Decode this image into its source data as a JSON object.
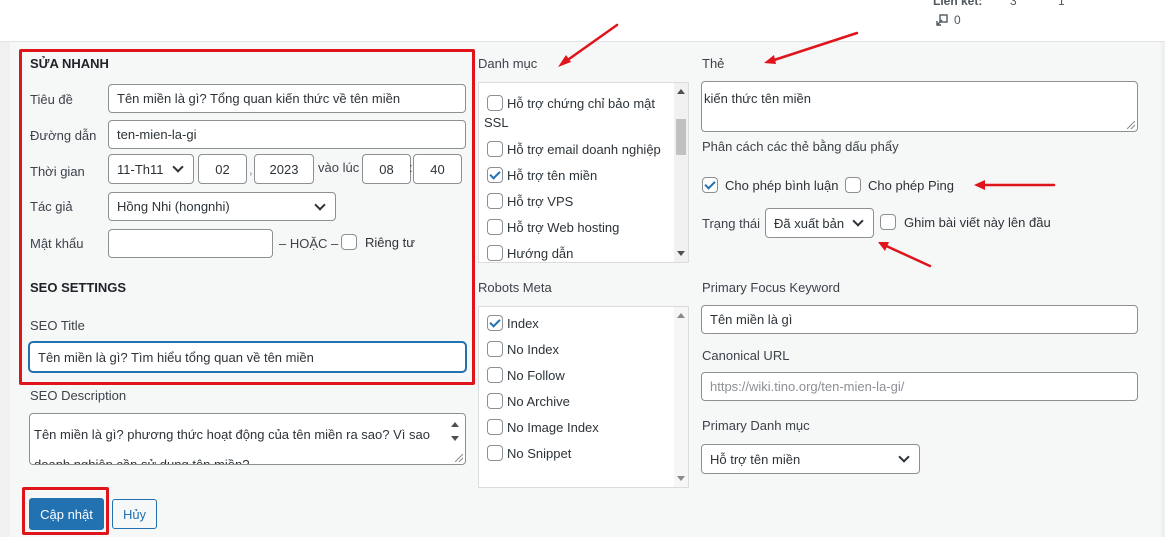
{
  "top": {
    "links_label": "Liên kết:",
    "links_counts": "3",
    "links_counts_2": "1",
    "incoming_count": "0"
  },
  "quick_edit": {
    "heading": "SỬA NHANH",
    "title_label": "Tiêu đề",
    "title_value": "Tên miền là gì? Tổng quan kiến thức về tên miền",
    "slug_label": "Đường dẫn",
    "slug_value": "ten-mien-la-gi",
    "date_label": "Thời gian",
    "month_value": "11-Th11",
    "day_value": "02",
    "year_value": "2023",
    "at_label": "vào lúc",
    "hour_value": "08",
    "minute_value": "40",
    "author_label": "Tác giả",
    "author_value": "Hồng Nhi (hongnhi)",
    "password_label": "Mật khẩu",
    "password_value": "",
    "or_label": "– HOẶC –",
    "private_label": "Riêng tư"
  },
  "seo": {
    "heading": "SEO SETTINGS",
    "title_label": "SEO Title",
    "title_value": "Tên miền là gì? Tìm hiểu tổng quan về tên miền",
    "description_label": "SEO Description",
    "description_value": "Tên miền là gì? phương thức hoạt động của tên miền ra sao? Vì sao doanh nghiệp cần sử dụng tên miền?"
  },
  "categories": {
    "heading": "Danh mục",
    "items": [
      {
        "label": "Hỗ trợ chứng chỉ bảo mật",
        "label_cont": "SSL",
        "checked": false
      },
      {
        "label": "Hỗ trợ email doanh nghiệp",
        "checked": false
      },
      {
        "label": "Hỗ trợ tên miền",
        "checked": true
      },
      {
        "label": "Hỗ trợ VPS",
        "checked": false
      },
      {
        "label": "Hỗ trợ Web hosting",
        "checked": false
      },
      {
        "label": "Hướng dẫn",
        "checked": false
      }
    ]
  },
  "robots": {
    "heading": "Robots Meta",
    "items": [
      {
        "label": "Index",
        "checked": true
      },
      {
        "label": "No Index",
        "checked": false
      },
      {
        "label": "No Follow",
        "checked": false
      },
      {
        "label": "No Archive",
        "checked": false
      },
      {
        "label": "No Image Index",
        "checked": false
      },
      {
        "label": "No Snippet",
        "checked": false
      }
    ]
  },
  "tags": {
    "heading": "Thẻ",
    "value": "kiến thức tên miền",
    "hint": "Phân cách các thẻ bằng dấu phẩy"
  },
  "options": {
    "allow_comments_label": "Cho phép bình luận",
    "allow_comments_checked": true,
    "allow_ping_label": "Cho phép Ping",
    "allow_ping_checked": false,
    "status_label": "Trạng thái",
    "status_value": "Đã xuất bản",
    "sticky_label": "Ghim bài viết này lên đầu",
    "sticky_checked": false
  },
  "seo_right": {
    "focus_keyword_label": "Primary Focus Keyword",
    "focus_keyword_value": "Tên miền là gì",
    "canonical_label": "Canonical URL",
    "canonical_placeholder": "https://wiki.tino.org/ten-mien-la-gi/",
    "primary_category_label": "Primary Danh mục",
    "primary_category_value": "Hỗ trợ tên miền"
  },
  "actions": {
    "update_label": "Cập nhật",
    "cancel_label": "Hủy"
  },
  "colors": {
    "annotation_red": "#e0141b",
    "primary_blue": "#2271b1"
  }
}
